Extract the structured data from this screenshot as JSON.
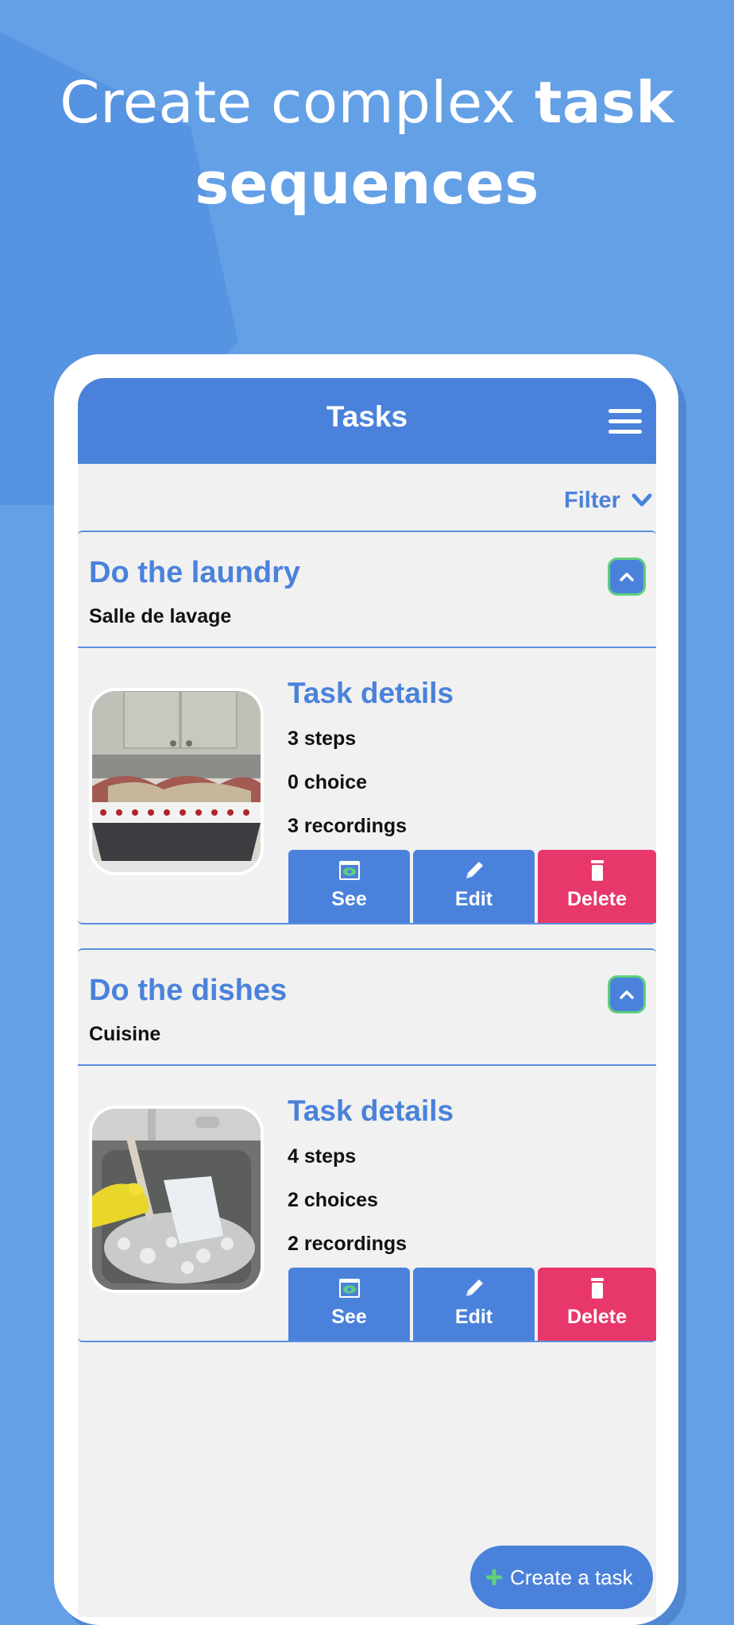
{
  "headline": {
    "regular": "Create complex ",
    "bold1": "task",
    "bold2": "sequences"
  },
  "colors": {
    "background": "#64a0e6",
    "primary": "#4a82db",
    "delete": "#e8376b",
    "toggle_border": "#5fd07a"
  },
  "appbar": {
    "title": "Tasks",
    "menu_icon": "hamburger-menu-icon"
  },
  "filter": {
    "label": "Filter",
    "icon": "chevron-down-icon"
  },
  "tasks": [
    {
      "title": "Do the laundry",
      "room": "Salle de lavage",
      "details_title": "Task details",
      "steps": "3 steps",
      "choices": "0 choice",
      "recordings": "3 recordings",
      "image": "laundry-basket-photo"
    },
    {
      "title": "Do the dishes",
      "room": "Cuisine",
      "details_title": "Task details",
      "steps": "4 steps",
      "choices": "2 choices",
      "recordings": "2 recordings",
      "image": "dishwashing-sink-photo"
    }
  ],
  "actions": {
    "see": "See",
    "edit": "Edit",
    "delete": "Delete"
  },
  "fab": {
    "label": "Create a task",
    "icon": "plus-icon"
  }
}
